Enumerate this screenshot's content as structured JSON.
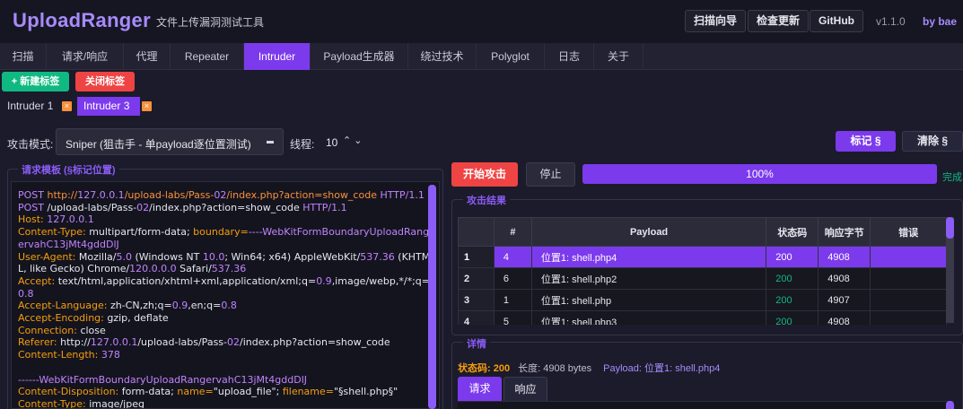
{
  "header": {
    "title": "UploadRanger",
    "subtitle": "文件上传漏洞测试工具",
    "buttons": [
      "扫描向导",
      "检查更新",
      "GitHub"
    ],
    "version": "v1.1.0",
    "author": "by bae"
  },
  "tabs": [
    "扫描",
    "请求/响应",
    "代理",
    "Repeater",
    "Intruder",
    "Payload生成器",
    "绕过技术",
    "Polyglot",
    "日志",
    "关于"
  ],
  "active_tab": "Intruder",
  "subtabs": {
    "new_label": "+ 新建标签",
    "close_label": "关闭标签",
    "items": [
      "Intruder 1",
      "Intruder 3"
    ],
    "close_icon": "×"
  },
  "mode": {
    "label": "攻击模式:",
    "value": "Sniper (狙击手 - 单payload逐位置测试)",
    "thread_label": "线程:",
    "thread_value": "10",
    "thread_arrows": "⌃⌄",
    "mark_label": "标记 §",
    "clear_label": "清除 §"
  },
  "template": {
    "legend": "请求模板 (§标记位置)",
    "lines": [
      [
        [
          "k",
          "POST "
        ],
        [
          "o",
          "http://"
        ],
        [
          "p",
          "127.0.0.1"
        ],
        [
          "o",
          "/upload-labs/Pass-"
        ],
        [
          "p",
          "02"
        ],
        [
          "o",
          "/index.php?action=show_code "
        ],
        [
          "p",
          "HTTP/1.1"
        ]
      ],
      [
        [
          "k",
          "POST "
        ],
        [
          "w",
          "/upload-labs/Pass-"
        ],
        [
          "p",
          "02"
        ],
        [
          "w",
          "/index.php?action=show_code "
        ],
        [
          "p",
          "HTTP/1.1"
        ]
      ],
      [
        [
          "y",
          "Host: "
        ],
        [
          "p",
          "127.0.0.1"
        ]
      ],
      [
        [
          "y",
          "Content-Type: "
        ],
        [
          "w",
          "multipart/form-data; "
        ],
        [
          "y",
          "boundary="
        ],
        [
          "p",
          "----WebKitFormBoundaryUploadRangervahC13jMt4gddDlJ"
        ]
      ],
      [
        [
          "y",
          "User-Agent: "
        ],
        [
          "w",
          "Mozilla/"
        ],
        [
          "p",
          "5.0"
        ],
        [
          "w",
          " (Windows NT "
        ],
        [
          "p",
          "10.0"
        ],
        [
          "w",
          "; Win64; x64) AppleWebKit/"
        ],
        [
          "p",
          "537.36"
        ],
        [
          "w",
          " (KHTML, like Gecko) Chrome/"
        ],
        [
          "p",
          "120.0.0.0"
        ],
        [
          "w",
          " Safari/"
        ],
        [
          "p",
          "537.36"
        ]
      ],
      [
        [
          "y",
          "Accept: "
        ],
        [
          "w",
          "text/html,application/xhtml+xml,application/xml;q="
        ],
        [
          "p",
          "0.9"
        ],
        [
          "w",
          ",image/webp,*/*;q="
        ],
        [
          "p",
          "0.8"
        ]
      ],
      [
        [
          "y",
          "Accept-Language: "
        ],
        [
          "w",
          "zh-CN,zh;q="
        ],
        [
          "p",
          "0.9"
        ],
        [
          "w",
          ",en;q="
        ],
        [
          "p",
          "0.8"
        ]
      ],
      [
        [
          "y",
          "Accept-Encoding: "
        ],
        [
          "w",
          "gzip, deflate"
        ]
      ],
      [
        [
          "y",
          "Connection: "
        ],
        [
          "w",
          "close"
        ]
      ],
      [
        [
          "y",
          "Referer: "
        ],
        [
          "w",
          "http://"
        ],
        [
          "p",
          "127.0.0.1"
        ],
        [
          "w",
          "/upload-labs/Pass-"
        ],
        [
          "p",
          "02"
        ],
        [
          "w",
          "/index.php?action=show_code"
        ]
      ],
      [
        [
          "y",
          "Content-Length: "
        ],
        [
          "p",
          "378"
        ]
      ],
      [
        [
          "w",
          " "
        ]
      ],
      [
        [
          "p",
          "------WebKitFormBoundaryUploadRangervahC13jMt4gddDlJ"
        ]
      ],
      [
        [
          "y",
          "Content-Disposition: "
        ],
        [
          "w",
          "form-data; "
        ],
        [
          "y",
          "name="
        ],
        [
          "w",
          "\"upload_file\"; "
        ],
        [
          "y",
          "filename="
        ],
        [
          "w",
          "\"§shell.php§\""
        ]
      ],
      [
        [
          "y",
          "Content-Type: "
        ],
        [
          "w",
          "image/jpeg"
        ]
      ]
    ]
  },
  "attack": {
    "start_label": "开始攻击",
    "stop_label": "停止",
    "progress_percent": 100,
    "progress_text": "100%",
    "done_text": "完成"
  },
  "results": {
    "legend": "攻击结果",
    "columns": [
      "#",
      "Payload",
      "状态码",
      "响应字节",
      "错误"
    ],
    "rows": [
      {
        "n": "1",
        "id": "4",
        "payload": "位置1: shell.php4",
        "status": "200",
        "bytes": "4908",
        "error": "",
        "selected": true
      },
      {
        "n": "2",
        "id": "6",
        "payload": "位置1: shell.php2",
        "status": "200",
        "bytes": "4908",
        "error": "",
        "selected": false
      },
      {
        "n": "3",
        "id": "1",
        "payload": "位置1: shell.php",
        "status": "200",
        "bytes": "4907",
        "error": "",
        "selected": false
      },
      {
        "n": "4",
        "id": "5",
        "payload": "位置1: shell.php3",
        "status": "200",
        "bytes": "4908",
        "error": "",
        "selected": false
      }
    ],
    "status_color": "#10b981"
  },
  "detail": {
    "legend": "详情",
    "status_text": "状态码: 200",
    "length_text": "长度: 4908 bytes",
    "payload_text": "Payload: 位置1: shell.php4",
    "tabs": [
      "请求",
      "响应"
    ]
  }
}
